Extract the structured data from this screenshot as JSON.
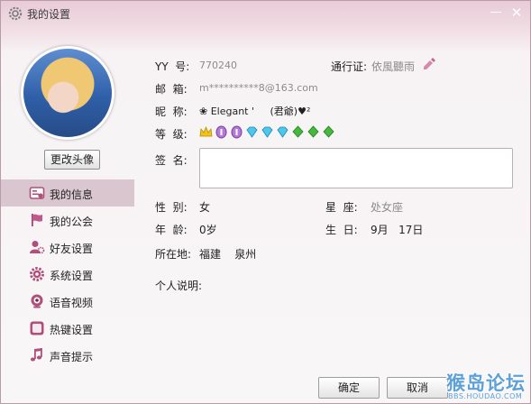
{
  "window": {
    "title": "我的设置",
    "minimize_symbol": "—",
    "close_symbol": "✕"
  },
  "profile": {
    "change_avatar_label": "更改头像"
  },
  "sidebar": {
    "items": [
      {
        "label": "我的信息",
        "icon": "profile-card-icon",
        "active": true
      },
      {
        "label": "我的公会",
        "icon": "flag-icon",
        "active": false
      },
      {
        "label": "好友设置",
        "icon": "friend-settings-icon",
        "active": false
      },
      {
        "label": "系统设置",
        "icon": "gear-icon",
        "active": false
      },
      {
        "label": "语音视频",
        "icon": "webcam-icon",
        "active": false
      },
      {
        "label": "热键设置",
        "icon": "hotkey-icon",
        "active": false
      },
      {
        "label": "声音提示",
        "icon": "music-note-icon",
        "active": false
      }
    ]
  },
  "info": {
    "yy_label": "YY  号:",
    "yy_value": "770240",
    "passport_label": "通行证:",
    "passport_value": "依風聽雨",
    "email_label": "邮  箱:",
    "email_value": "m**********8@163.com",
    "nickname_label": "昵  称:",
    "nickname_value": "❀ Elegant '     (君爺)♥²",
    "level_label": "等  级:",
    "level_icons": [
      "crown",
      "purple-shield",
      "purple-shield",
      "diamond",
      "diamond",
      "diamond",
      "leaf",
      "leaf",
      "leaf"
    ],
    "signature_label": "签  名:",
    "signature_value": "",
    "gender_label": "性  别:",
    "gender_value": "女",
    "zodiac_label": "星  座:",
    "zodiac_value": "处女座",
    "age_label": "年  龄:",
    "age_value": "0岁",
    "birthday_label": "生  日:",
    "birthday_value": "9月   17日",
    "location_label": "所在地:",
    "location_value": "福建    泉州",
    "bio_label": "个人说明:"
  },
  "buttons": {
    "ok": "确定",
    "cancel": "取消"
  },
  "watermark": {
    "main": "猴岛论坛",
    "sub": "BBS.HOUDAO.COM"
  }
}
